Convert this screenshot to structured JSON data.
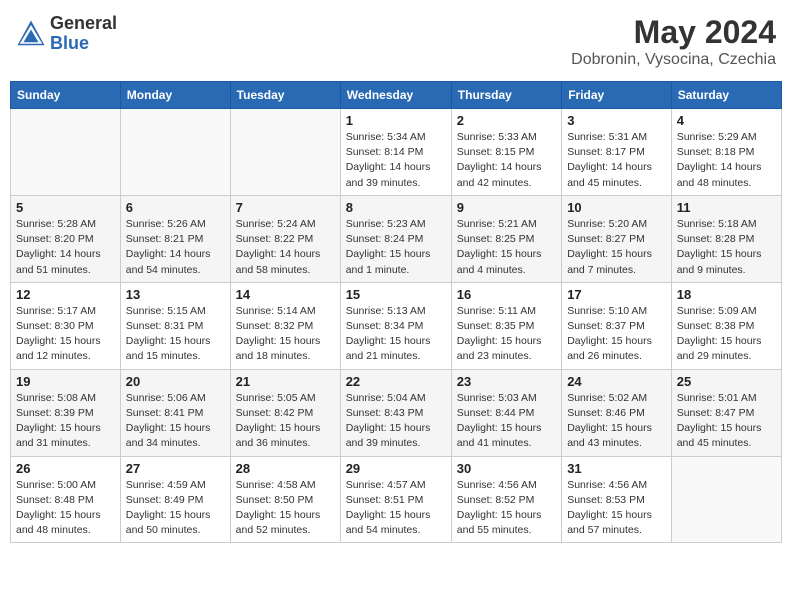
{
  "header": {
    "logo_general": "General",
    "logo_blue": "Blue",
    "title": "May 2024",
    "location": "Dobronin, Vysocina, Czechia"
  },
  "weekdays": [
    "Sunday",
    "Monday",
    "Tuesday",
    "Wednesday",
    "Thursday",
    "Friday",
    "Saturday"
  ],
  "weeks": [
    [
      {
        "day": "",
        "info": ""
      },
      {
        "day": "",
        "info": ""
      },
      {
        "day": "",
        "info": ""
      },
      {
        "day": "1",
        "info": "Sunrise: 5:34 AM\nSunset: 8:14 PM\nDaylight: 14 hours\nand 39 minutes."
      },
      {
        "day": "2",
        "info": "Sunrise: 5:33 AM\nSunset: 8:15 PM\nDaylight: 14 hours\nand 42 minutes."
      },
      {
        "day": "3",
        "info": "Sunrise: 5:31 AM\nSunset: 8:17 PM\nDaylight: 14 hours\nand 45 minutes."
      },
      {
        "day": "4",
        "info": "Sunrise: 5:29 AM\nSunset: 8:18 PM\nDaylight: 14 hours\nand 48 minutes."
      }
    ],
    [
      {
        "day": "5",
        "info": "Sunrise: 5:28 AM\nSunset: 8:20 PM\nDaylight: 14 hours\nand 51 minutes."
      },
      {
        "day": "6",
        "info": "Sunrise: 5:26 AM\nSunset: 8:21 PM\nDaylight: 14 hours\nand 54 minutes."
      },
      {
        "day": "7",
        "info": "Sunrise: 5:24 AM\nSunset: 8:22 PM\nDaylight: 14 hours\nand 58 minutes."
      },
      {
        "day": "8",
        "info": "Sunrise: 5:23 AM\nSunset: 8:24 PM\nDaylight: 15 hours\nand 1 minute."
      },
      {
        "day": "9",
        "info": "Sunrise: 5:21 AM\nSunset: 8:25 PM\nDaylight: 15 hours\nand 4 minutes."
      },
      {
        "day": "10",
        "info": "Sunrise: 5:20 AM\nSunset: 8:27 PM\nDaylight: 15 hours\nand 7 minutes."
      },
      {
        "day": "11",
        "info": "Sunrise: 5:18 AM\nSunset: 8:28 PM\nDaylight: 15 hours\nand 9 minutes."
      }
    ],
    [
      {
        "day": "12",
        "info": "Sunrise: 5:17 AM\nSunset: 8:30 PM\nDaylight: 15 hours\nand 12 minutes."
      },
      {
        "day": "13",
        "info": "Sunrise: 5:15 AM\nSunset: 8:31 PM\nDaylight: 15 hours\nand 15 minutes."
      },
      {
        "day": "14",
        "info": "Sunrise: 5:14 AM\nSunset: 8:32 PM\nDaylight: 15 hours\nand 18 minutes."
      },
      {
        "day": "15",
        "info": "Sunrise: 5:13 AM\nSunset: 8:34 PM\nDaylight: 15 hours\nand 21 minutes."
      },
      {
        "day": "16",
        "info": "Sunrise: 5:11 AM\nSunset: 8:35 PM\nDaylight: 15 hours\nand 23 minutes."
      },
      {
        "day": "17",
        "info": "Sunrise: 5:10 AM\nSunset: 8:37 PM\nDaylight: 15 hours\nand 26 minutes."
      },
      {
        "day": "18",
        "info": "Sunrise: 5:09 AM\nSunset: 8:38 PM\nDaylight: 15 hours\nand 29 minutes."
      }
    ],
    [
      {
        "day": "19",
        "info": "Sunrise: 5:08 AM\nSunset: 8:39 PM\nDaylight: 15 hours\nand 31 minutes."
      },
      {
        "day": "20",
        "info": "Sunrise: 5:06 AM\nSunset: 8:41 PM\nDaylight: 15 hours\nand 34 minutes."
      },
      {
        "day": "21",
        "info": "Sunrise: 5:05 AM\nSunset: 8:42 PM\nDaylight: 15 hours\nand 36 minutes."
      },
      {
        "day": "22",
        "info": "Sunrise: 5:04 AM\nSunset: 8:43 PM\nDaylight: 15 hours\nand 39 minutes."
      },
      {
        "day": "23",
        "info": "Sunrise: 5:03 AM\nSunset: 8:44 PM\nDaylight: 15 hours\nand 41 minutes."
      },
      {
        "day": "24",
        "info": "Sunrise: 5:02 AM\nSunset: 8:46 PM\nDaylight: 15 hours\nand 43 minutes."
      },
      {
        "day": "25",
        "info": "Sunrise: 5:01 AM\nSunset: 8:47 PM\nDaylight: 15 hours\nand 45 minutes."
      }
    ],
    [
      {
        "day": "26",
        "info": "Sunrise: 5:00 AM\nSunset: 8:48 PM\nDaylight: 15 hours\nand 48 minutes."
      },
      {
        "day": "27",
        "info": "Sunrise: 4:59 AM\nSunset: 8:49 PM\nDaylight: 15 hours\nand 50 minutes."
      },
      {
        "day": "28",
        "info": "Sunrise: 4:58 AM\nSunset: 8:50 PM\nDaylight: 15 hours\nand 52 minutes."
      },
      {
        "day": "29",
        "info": "Sunrise: 4:57 AM\nSunset: 8:51 PM\nDaylight: 15 hours\nand 54 minutes."
      },
      {
        "day": "30",
        "info": "Sunrise: 4:56 AM\nSunset: 8:52 PM\nDaylight: 15 hours\nand 55 minutes."
      },
      {
        "day": "31",
        "info": "Sunrise: 4:56 AM\nSunset: 8:53 PM\nDaylight: 15 hours\nand 57 minutes."
      },
      {
        "day": "",
        "info": ""
      }
    ]
  ]
}
